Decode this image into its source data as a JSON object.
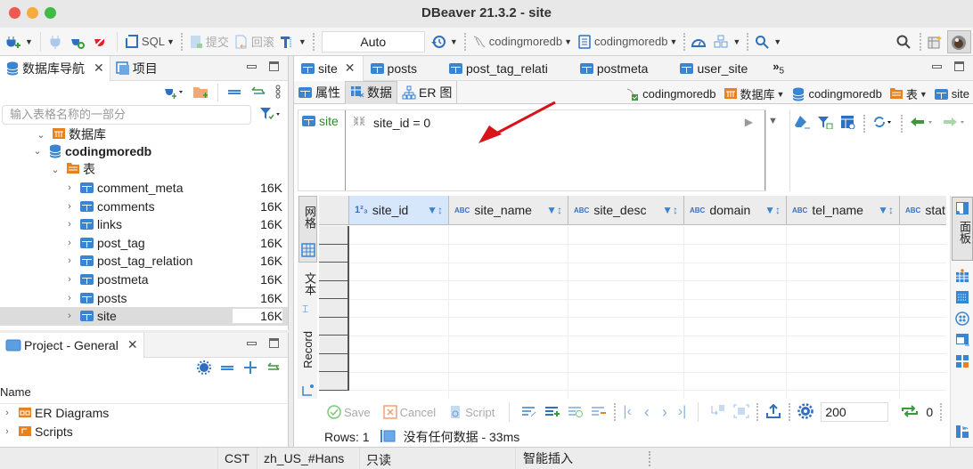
{
  "window": {
    "title": "DBeaver 21.3.2 - site"
  },
  "toolbar": {
    "sql_label": "SQL",
    "commit_label": "提交",
    "rollback_label": "回滚",
    "transaction_mode": "Auto",
    "datasource_label": "codingmoredb",
    "schema_label": "codingmoredb"
  },
  "navigator": {
    "tab_label": "数据库导航",
    "projects_tab_label": "项目",
    "filter_placeholder": "输入表格名称的一部分",
    "tree": {
      "databases_label": "数据库",
      "db_name": "codingmoredb",
      "tables_label": "表",
      "tables": [
        {
          "name": "comment_meta",
          "size": "16K"
        },
        {
          "name": "comments",
          "size": "16K"
        },
        {
          "name": "links",
          "size": "16K"
        },
        {
          "name": "post_tag",
          "size": "16K"
        },
        {
          "name": "post_tag_relation",
          "size": "16K"
        },
        {
          "name": "postmeta",
          "size": "16K"
        },
        {
          "name": "posts",
          "size": "16K"
        },
        {
          "name": "site",
          "size": "16K"
        }
      ]
    }
  },
  "project": {
    "tab_label": "Project - General",
    "column_header": "Name",
    "items": [
      {
        "name": "ER Diagrams"
      },
      {
        "name": "Scripts"
      }
    ]
  },
  "editor": {
    "tabs": [
      {
        "label": "site"
      },
      {
        "label": "posts"
      },
      {
        "label": "post_tag_relati"
      },
      {
        "label": "postmeta"
      },
      {
        "label": "user_site"
      }
    ],
    "overflow_label": "»",
    "overflow_count": "5",
    "subtabs": [
      {
        "label": "属性"
      },
      {
        "label": "数据"
      },
      {
        "label": "ER 图"
      }
    ],
    "breadcrumbs": {
      "connection": "codingmoredb",
      "databases": "数据库",
      "db": "codingmoredb",
      "tables": "表",
      "table": "site"
    },
    "filter": {
      "entity_label": "site",
      "expression": "site_id = 0"
    },
    "grid": {
      "columns": [
        {
          "name": "site_id",
          "type": "123"
        },
        {
          "name": "site_name",
          "type": "ABC"
        },
        {
          "name": "site_desc",
          "type": "ABC"
        },
        {
          "name": "domain",
          "type": "ABC"
        },
        {
          "name": "tel_name",
          "type": "ABC"
        },
        {
          "name": "stat",
          "type": "ABC"
        }
      ]
    },
    "side_tabs": {
      "grid": "网格",
      "text": "文本",
      "record": "Record"
    },
    "right_tab": "面板",
    "bottom": {
      "save": "Save",
      "cancel": "Cancel",
      "script": "Script",
      "fetch_size": "200",
      "refresh_count": "0"
    },
    "status": {
      "rows": "Rows: 1",
      "message": "没有任何数据 - 33ms"
    }
  },
  "statusbar": {
    "timezone": "CST",
    "locale": "zh_US_#Hans",
    "mode": "只读",
    "insert_mode": "智能插入"
  },
  "colors": {
    "accent": "#3b84d0",
    "orange": "#e8821e",
    "green": "#3a9a3a",
    "red_arrow": "#d9131a"
  }
}
